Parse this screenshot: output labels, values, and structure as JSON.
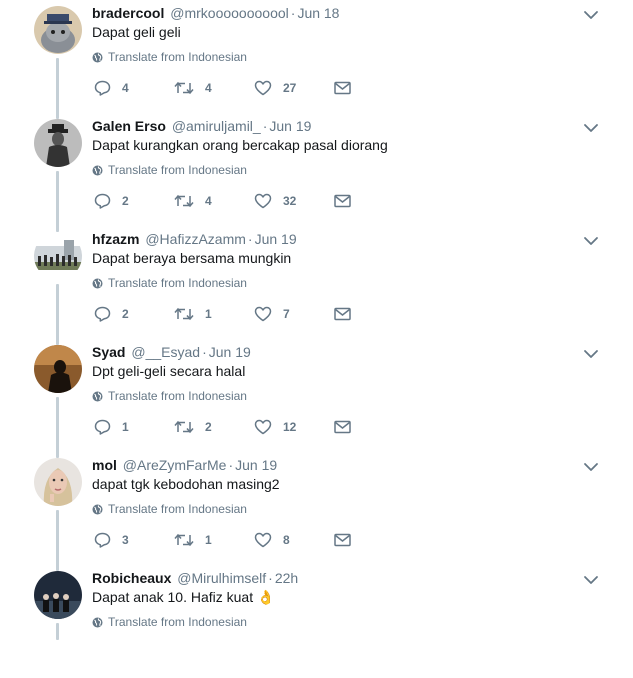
{
  "feed": {
    "tweets": [
      {
        "name": "bradercool",
        "handle": "@mrkooooooooool",
        "time": "Jun 18",
        "text": "Dapat geli geli",
        "translate": "Translate from Indonesian",
        "replies": "4",
        "retweets": "4",
        "likes": "27"
      },
      {
        "name": "Galen Erso",
        "handle": "@amiruljamil_",
        "time": "Jun 19",
        "text": "Dapat kurangkan orang bercakap pasal diorang",
        "translate": "Translate from Indonesian",
        "replies": "2",
        "retweets": "4",
        "likes": "32"
      },
      {
        "name": "hfzazm",
        "handle": "@HafizzAzamm",
        "time": "Jun 19",
        "text": "Dapat beraya bersama mungkin",
        "translate": "Translate from Indonesian",
        "replies": "2",
        "retweets": "1",
        "likes": "7"
      },
      {
        "name": "Syad",
        "handle": "@__Esyad",
        "time": "Jun 19",
        "text": "Dpt geli-geli secara halal",
        "translate": "Translate from Indonesian",
        "replies": "1",
        "retweets": "2",
        "likes": "12"
      },
      {
        "name": "mol",
        "handle": "@AreZymFarMe",
        "time": "Jun 19",
        "text": "dapat tgk kebodohan masing2",
        "translate": "Translate from Indonesian",
        "replies": "3",
        "retweets": "1",
        "likes": "8"
      },
      {
        "name": "Robicheaux",
        "handle": "@Mirulhimself",
        "time": "22h",
        "text": "Dapat anak 10. Hafiz kuat 👌",
        "translate": "Translate from Indonesian",
        "replies": "",
        "retweets": "",
        "likes": ""
      }
    ],
    "separator": "·",
    "icons": {
      "reply": "reply-icon",
      "retweet": "retweet-icon",
      "like": "heart-icon",
      "dm": "envelope-icon",
      "globe": "globe-icon",
      "caret": "chevron-down-icon"
    },
    "colors": {
      "icon_gray": "#657786",
      "text": "#14171a",
      "thread_line": "#c4cfd6"
    }
  }
}
